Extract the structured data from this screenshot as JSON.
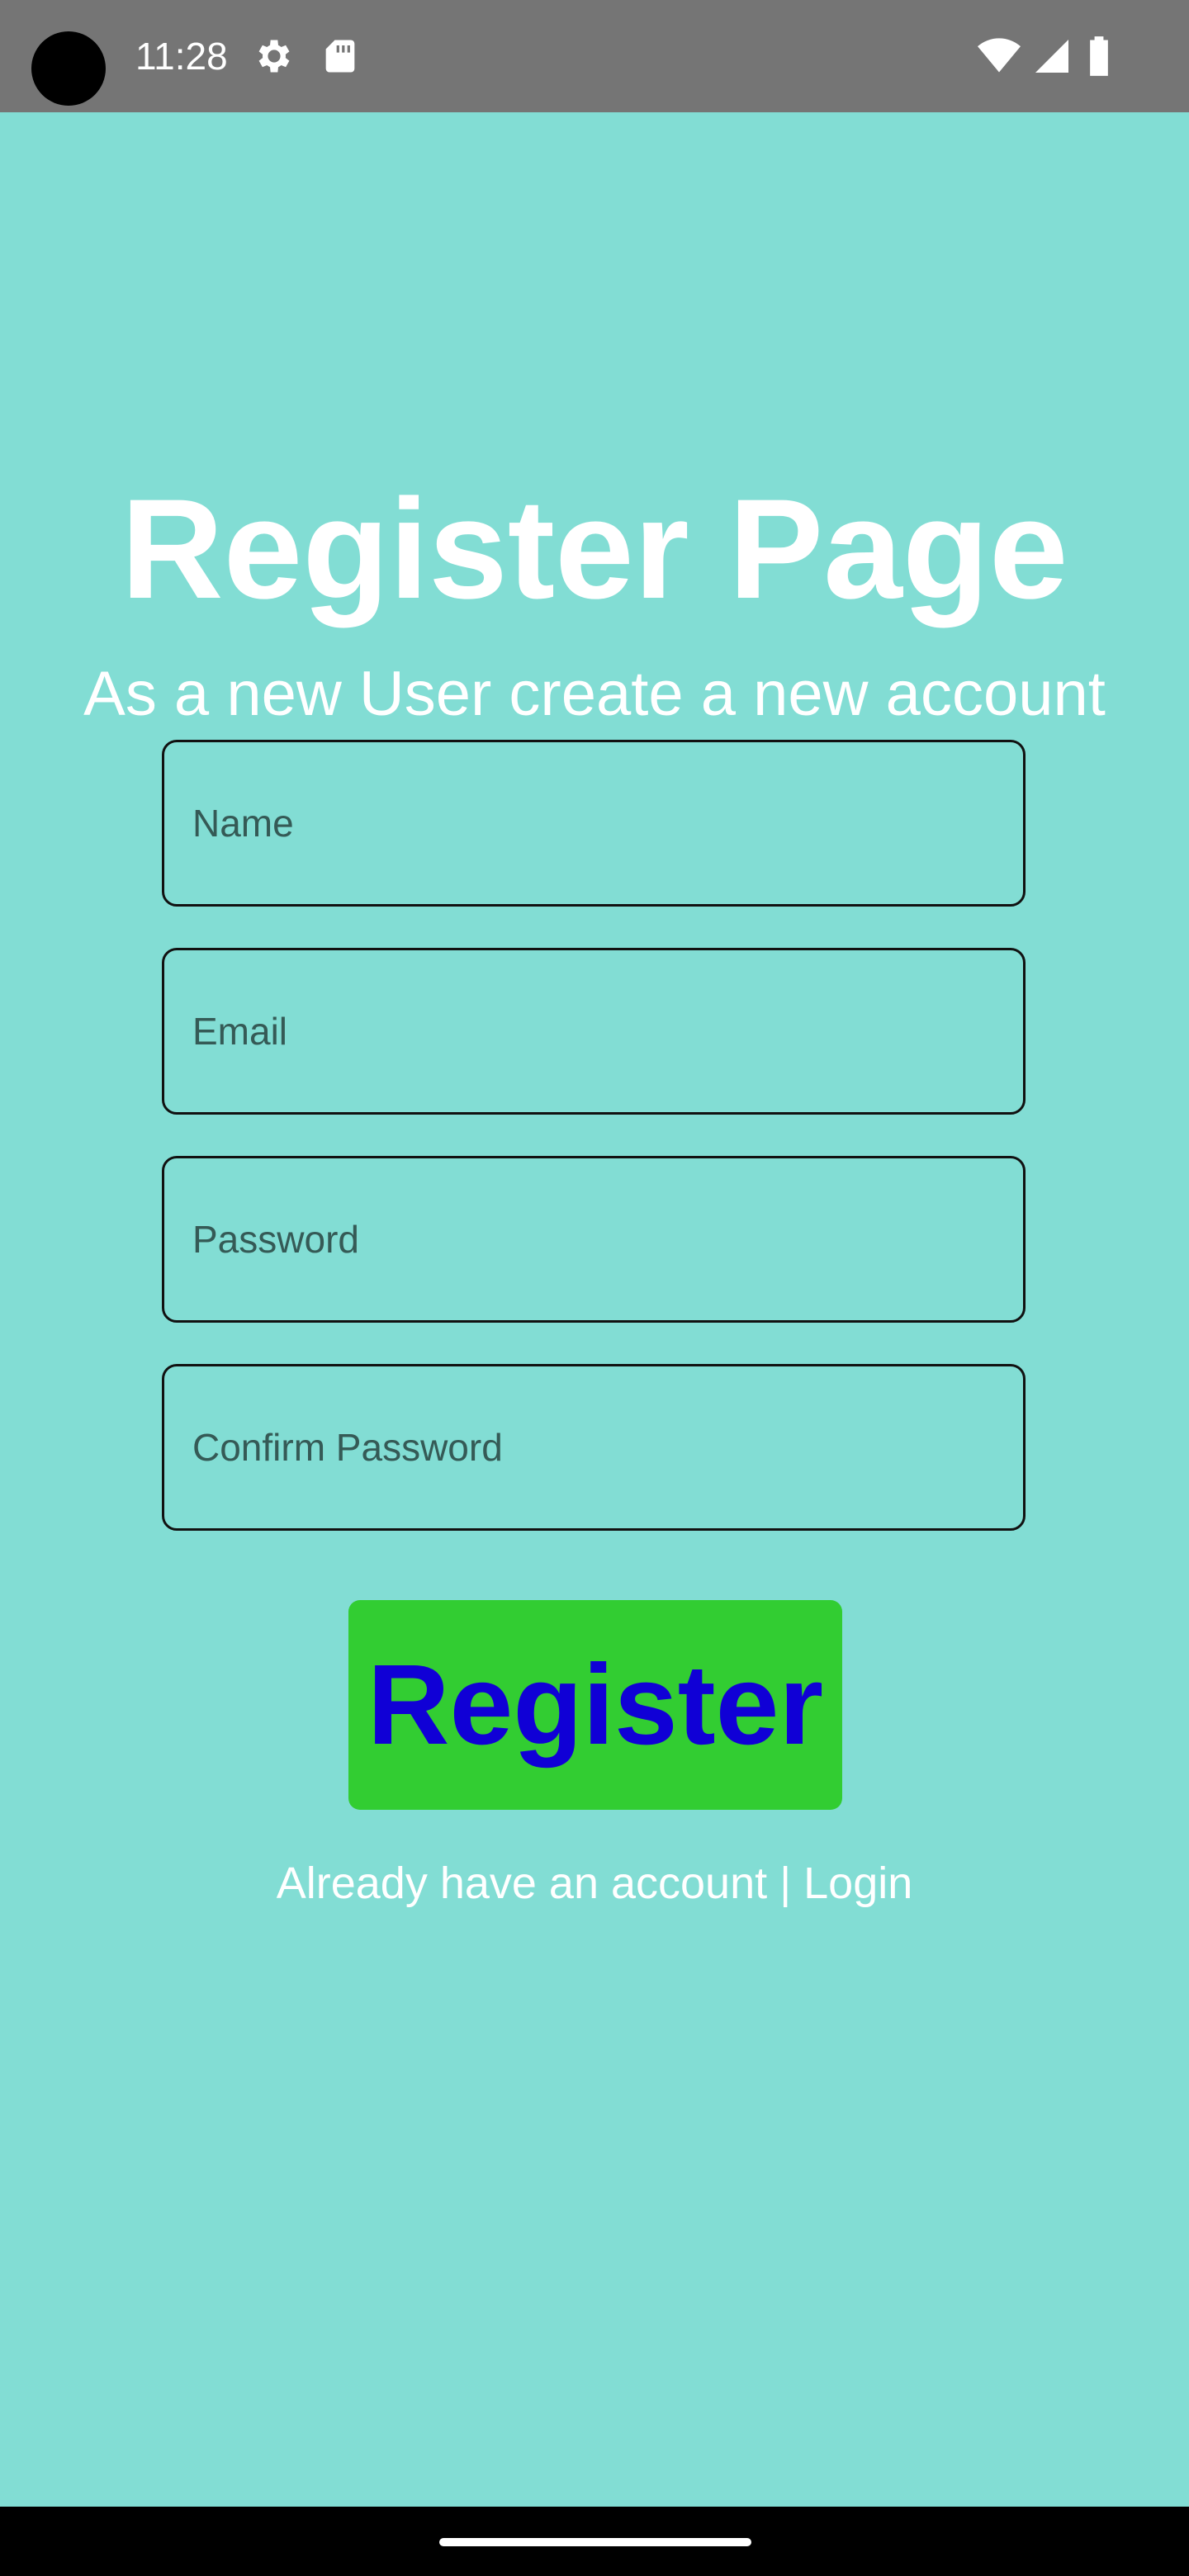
{
  "status_bar": {
    "time": "11:28",
    "icons": [
      "camera-dot",
      "gear-icon",
      "sd-card-icon",
      "wifi-icon",
      "signal-icon",
      "battery-icon"
    ]
  },
  "page": {
    "title": "Register Page",
    "subtitle": "As a new User create a new account"
  },
  "form": {
    "name_placeholder": "Name",
    "email_placeholder": "Email",
    "password_placeholder": "Password",
    "confirm_password_placeholder": "Confirm Password",
    "register_label": "Register",
    "login_link": "Already have an account | Login"
  },
  "colors": {
    "background": "#82ddd4",
    "status_bar": "#757575",
    "button_bg": "#32cd32",
    "button_text": "#1000d6",
    "text_light": "#ffffff"
  }
}
